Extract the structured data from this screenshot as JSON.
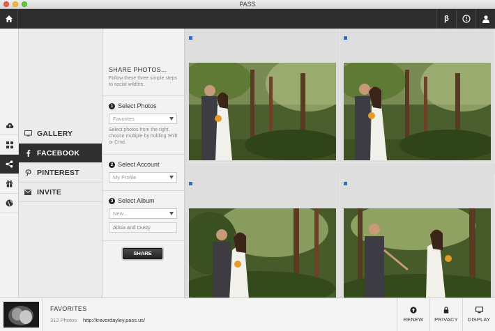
{
  "window": {
    "title": "PASS"
  },
  "topbar": {
    "home_icon": "home-icon",
    "beta_label": "β",
    "help_icon": "help-icon",
    "user_icon": "user-icon"
  },
  "rail": {
    "items": [
      "cloud-upload-icon",
      "grid-icon",
      "share-icon",
      "gift-icon",
      "globe-icon"
    ],
    "active": "share-icon"
  },
  "menu": {
    "items": [
      {
        "label": "GALLERY",
        "icon": "monitor-icon"
      },
      {
        "label": "FACEBOOK",
        "icon": "facebook-icon"
      },
      {
        "label": "PINTEREST",
        "icon": "pinterest-icon"
      },
      {
        "label": "INVITE",
        "icon": "envelope-icon"
      }
    ],
    "active": "FACEBOOK"
  },
  "steps": {
    "title": "SHARE PHOTOS...",
    "intro": "Follow these three simple steps to social wildfire.",
    "step1": {
      "num": "1",
      "label": "Select Photos",
      "select_value": "Favorites",
      "hint": "Select photos from the right, choose multiple by holding Shift or Cmd."
    },
    "step2": {
      "num": "2",
      "label": "Select Account",
      "select_value": "My Profile"
    },
    "step3": {
      "num": "3",
      "label": "Select Album",
      "select_value": "New...",
      "album_name": "Alisia and Dusty"
    },
    "share_button": "SHARE"
  },
  "gallery": {
    "photos": [
      "wedding-couple-kiss-photo",
      "wedding-couple-kiss-photo",
      "wedding-couple-smile-photo",
      "wedding-couple-walking-photo"
    ]
  },
  "bottombar": {
    "title": "FAVORITES",
    "count": "312 Photos",
    "url": "http://trevordayley.pass.us/",
    "buttons": [
      {
        "label": "RENEW",
        "icon": "arrow-up-circle-icon"
      },
      {
        "label": "PRIVACY",
        "icon": "lock-icon"
      },
      {
        "label": "DISPLAY",
        "icon": "monitor-icon"
      }
    ]
  },
  "colors": {
    "topbar": "#2d2d2d",
    "active": "#2f2f2f",
    "marker": "#2a6ed8"
  }
}
